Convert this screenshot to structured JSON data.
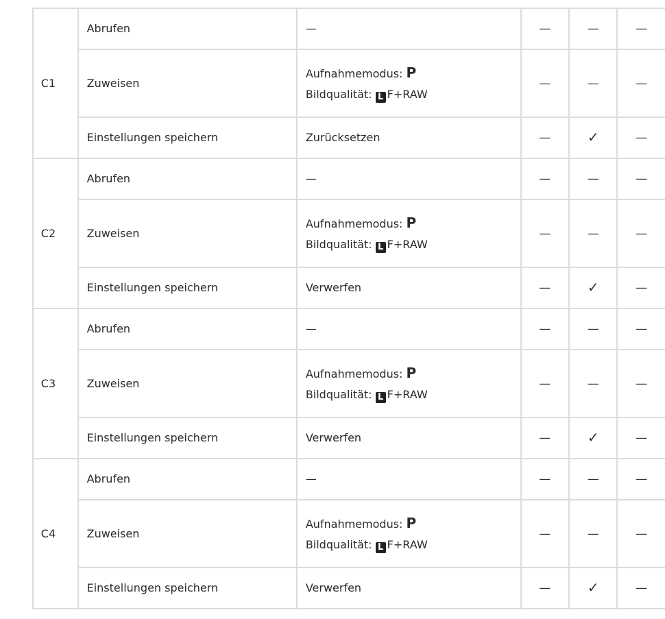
{
  "symbols": {
    "dash": "—",
    "check": "✓",
    "quality_icon": "L"
  },
  "value_template": {
    "mode_label": "Aufnahmemodus:",
    "mode_value": "P",
    "quality_label": "Bildqualität:",
    "quality_suffix": "F+RAW"
  },
  "groups": [
    {
      "label": "C1",
      "rows": [
        {
          "function": "Abrufen",
          "value": "—",
          "marks": [
            "—",
            "—",
            "—"
          ]
        },
        {
          "function": "Zuweisen",
          "value": "Aufnahmemodus / Bildqualität",
          "marks": [
            "—",
            "—",
            "—"
          ]
        },
        {
          "function": "Einstellungen speichern",
          "value": "Zurücksetzen",
          "marks": [
            "—",
            "✓",
            "—"
          ]
        }
      ]
    },
    {
      "label": "C2",
      "rows": [
        {
          "function": "Abrufen",
          "value": "—",
          "marks": [
            "—",
            "—",
            "—"
          ]
        },
        {
          "function": "Zuweisen",
          "value": "Aufnahmemodus / Bildqualität",
          "marks": [
            "—",
            "—",
            "—"
          ]
        },
        {
          "function": "Einstellungen speichern",
          "value": "Verwerfen",
          "marks": [
            "—",
            "✓",
            "—"
          ]
        }
      ]
    },
    {
      "label": "C3",
      "rows": [
        {
          "function": "Abrufen",
          "value": "—",
          "marks": [
            "—",
            "—",
            "—"
          ]
        },
        {
          "function": "Zuweisen",
          "value": "Aufnahmemodus / Bildqualität",
          "marks": [
            "—",
            "—",
            "—"
          ]
        },
        {
          "function": "Einstellungen speichern",
          "value": "Verwerfen",
          "marks": [
            "—",
            "✓",
            "—"
          ]
        }
      ]
    },
    {
      "label": "C4",
      "rows": [
        {
          "function": "Abrufen",
          "value": "—",
          "marks": [
            "—",
            "—",
            "—"
          ]
        },
        {
          "function": "Zuweisen",
          "value": "Aufnahmemodus / Bildqualität",
          "marks": [
            "—",
            "—",
            "—"
          ]
        },
        {
          "function": "Einstellungen speichern",
          "value": "Verwerfen",
          "marks": [
            "—",
            "✓",
            "—"
          ]
        }
      ]
    }
  ]
}
